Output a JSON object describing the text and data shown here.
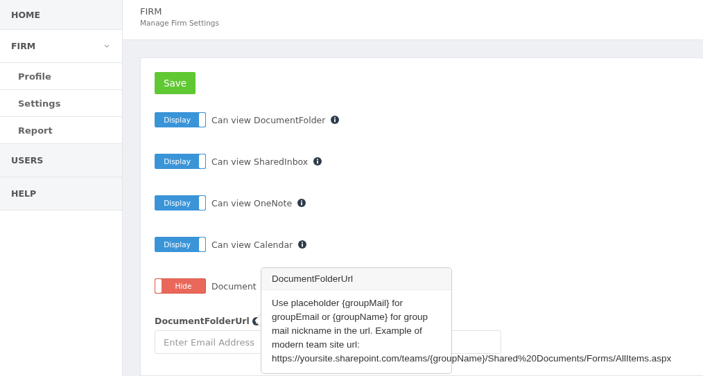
{
  "sidebar": {
    "items": [
      {
        "label": "HOME"
      },
      {
        "label": "FIRM",
        "expanded": true,
        "children": [
          {
            "label": "Profile"
          },
          {
            "label": "Settings"
          },
          {
            "label": "Report"
          }
        ]
      },
      {
        "label": "USERS"
      },
      {
        "label": "HELP"
      }
    ]
  },
  "header": {
    "title": "FIRM",
    "subtitle": "Manage Firm Settings"
  },
  "save_button": "Save",
  "toggles": [
    {
      "state_label": "Display",
      "on": true,
      "label": "Can view DocumentFolder"
    },
    {
      "state_label": "Display",
      "on": true,
      "label": "Can view SharedInbox"
    },
    {
      "state_label": "Display",
      "on": true,
      "label": "Can view OneNote"
    },
    {
      "state_label": "Display",
      "on": true,
      "label": "Can view Calendar"
    },
    {
      "state_label": "Hide",
      "on": false,
      "label": "Document"
    }
  ],
  "field": {
    "label": "DocumentFolderUrl",
    "placeholder": "Enter Email Address"
  },
  "tooltip": {
    "title": "DocumentFolderUrl",
    "text": "Use placeholder {groupMail} for groupEmail or {groupName} for group mail nickname in the url. Example of modern team site url:",
    "example_url": "https://yoursite.sharepoint.com/teams/{groupName}/Shared%20Documents/Forms/AllItems.aspx"
  }
}
